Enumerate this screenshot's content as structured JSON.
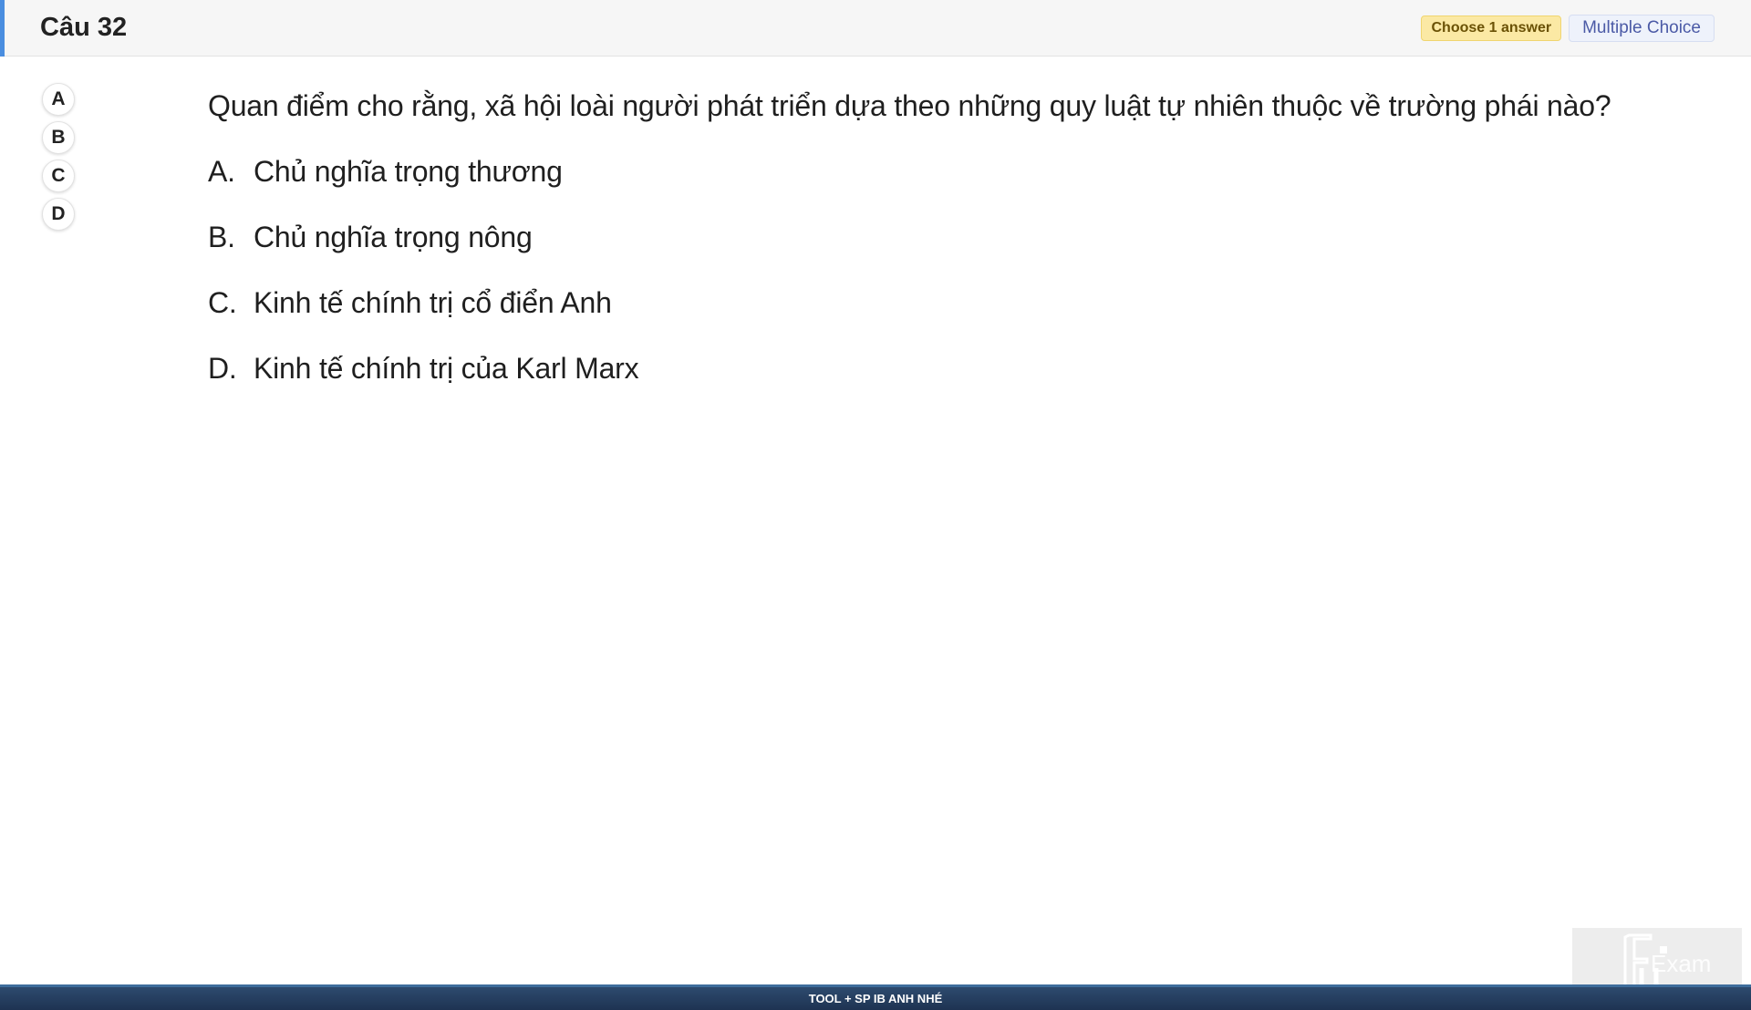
{
  "header": {
    "title": "Câu 32",
    "badge_choose": "Choose 1 answer",
    "badge_type": "Multiple Choice",
    "accent_color": "#4a8ee0"
  },
  "answers": [
    {
      "label": "A"
    },
    {
      "label": "B"
    },
    {
      "label": "C"
    },
    {
      "label": "D"
    }
  ],
  "question": {
    "text": "Quan điểm cho rằng, xã hội loài người phát triển dựa theo những quy luật tự nhiên thuộc về trường phái nào?",
    "options": [
      {
        "letter": "A.",
        "text": "Chủ nghĩa trọng thương"
      },
      {
        "letter": "B.",
        "text": "Chủ nghĩa trọng nông"
      },
      {
        "letter": "C.",
        "text": "Kinh tế chính trị cổ điển Anh"
      },
      {
        "letter": "D.",
        "text": "Kinh tế chính trị của Karl Marx"
      }
    ]
  },
  "watermark": {
    "logo_text": "FUExam",
    "icon": "fu-exam-logo"
  },
  "footer": {
    "text": "TOOL + SP IB ANH NHÉ"
  }
}
